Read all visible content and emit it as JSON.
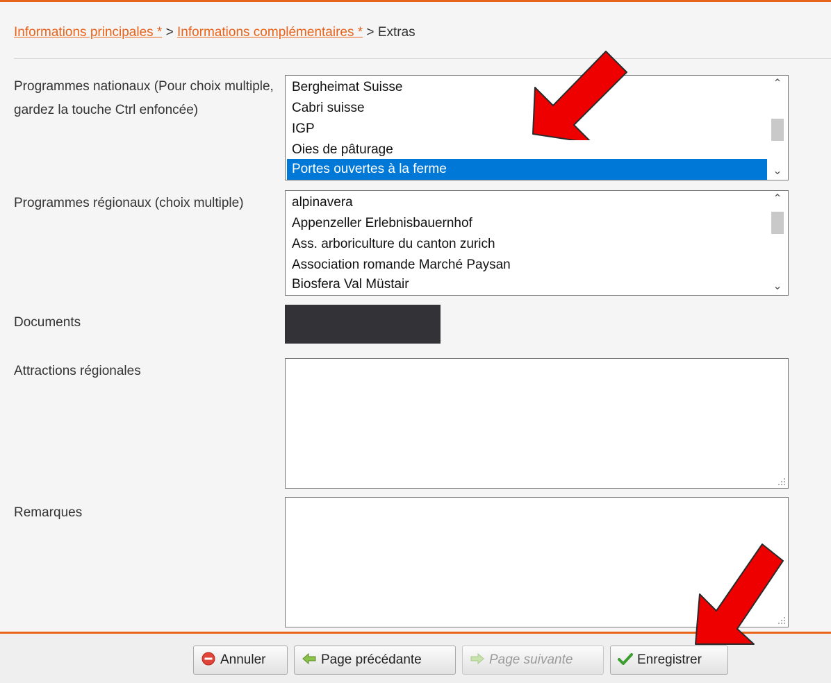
{
  "breadcrumb": {
    "step1": "Informations principales *",
    "step2": "Informations complémentaires *",
    "separator": " > ",
    "current": "Extras"
  },
  "form": {
    "national_label": "Programmes nationaux (Pour choix multiple, gardez la touche Ctrl enfoncée)",
    "national_options": [
      {
        "label": "Bergheimat Suisse",
        "selected": false
      },
      {
        "label": "Cabri suisse",
        "selected": false
      },
      {
        "label": "IGP",
        "selected": false
      },
      {
        "label": "Oies de pâturage",
        "selected": false
      },
      {
        "label": "Portes ouvertes à la ferme",
        "selected": true
      }
    ],
    "regional_label": "Programmes régionaux (choix multiple)",
    "regional_options": [
      {
        "label": "alpinavera",
        "selected": false
      },
      {
        "label": "Appenzeller Erlebnisbauernhof",
        "selected": false
      },
      {
        "label": "Ass. arboriculture du canton zurich",
        "selected": false
      },
      {
        "label": "Association romande Marché Paysan",
        "selected": false
      },
      {
        "label": "Biosfera Val Müstair",
        "selected": false
      }
    ],
    "documents_label": "Documents",
    "attractions_label": "Attractions régionales",
    "attractions_value": "",
    "remarks_label": "Remarques",
    "remarks_value": ""
  },
  "buttons": {
    "cancel": "Annuler",
    "previous": "Page précédante",
    "next": "Page suivante",
    "save": "Enregistrer"
  },
  "icons": {
    "cancel": "cancel-circle-icon",
    "previous": "arrow-left-icon",
    "next": "arrow-right-icon",
    "save": "checkmark-icon",
    "annotation": "red-arrow-icon"
  },
  "colors": {
    "accent": "#e8641b",
    "selection": "#0078d7",
    "annotation_arrow": "#ee0000"
  }
}
